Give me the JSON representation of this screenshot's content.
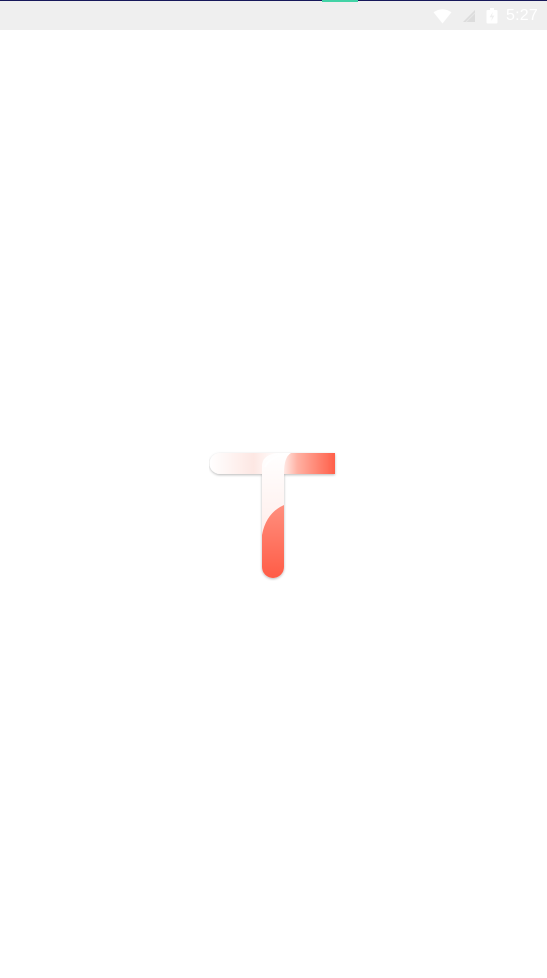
{
  "status_bar": {
    "time": "5:27",
    "icons": [
      "wifi-icon",
      "signal-icon",
      "battery-icon"
    ],
    "background_color": "#efefef",
    "indicator_color": "#43d3a6"
  },
  "splash": {
    "logo_icon": "t-logo-icon",
    "accent_color": "#ff6f5a"
  }
}
